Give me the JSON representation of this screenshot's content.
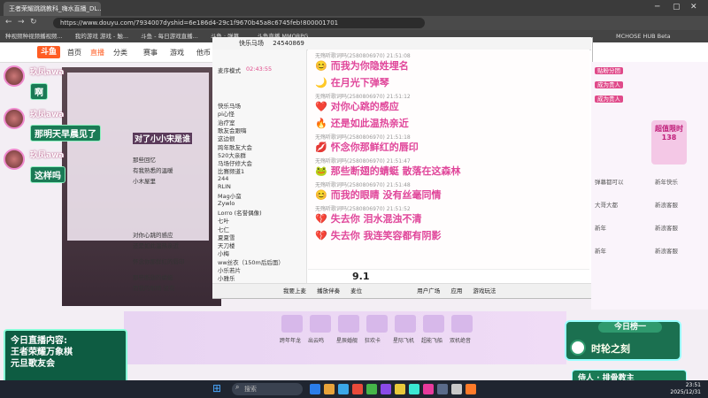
{
  "browser": {
    "tab_title": "王者荣耀跳跳教科_嗨水直播_DL...",
    "url": "https://www.douyu.com/7934007dyshid=6e186d4-29c1f9670b45a8c6745feb!800001701",
    "bookmarks": [
      "种视频种视频播视频...",
      "我的游戏 游戏 - 触...",
      "斗鱼 - 每日游戏直播...",
      "斗鱼 · 弹幕...",
      "斗鱼直播 MMORPG",
      "MCHOSE HUB Beta"
    ]
  },
  "site": {
    "logo": "斗鱼",
    "nav": [
      "首页",
      "直播",
      "分类",
      "赛事",
      "游戏",
      "他币"
    ],
    "active_nav": "直播"
  },
  "left_chat": [
    {
      "user": "玖凤awa",
      "message": "啊"
    },
    {
      "user": "玖凤awa",
      "message": "那明天早晨见了"
    },
    {
      "user": "玖凤awa",
      "message": "这样吗"
    }
  ],
  "qq_window": {
    "title": "快乐马场",
    "room_id": "24540869",
    "mode": "麦序模式",
    "timer": "02:43:55",
    "list_items": [
      "快乐马场",
      "pi心怪",
      "治疗室",
      "歌友会跟嗨",
      "这边很",
      "跨年歌友大会",
      "520大亲群",
      "马场仔修大会",
      "比赛频道1",
      "244",
      "RLIN",
      "Mag小蛮",
      "Zywlo",
      "Lorro (名誉偶像)",
      "七叶",
      "七仁",
      "夏夏雪",
      "天刀楼",
      "小梅",
      "ww丝衣（150m后后面）",
      "小乐若片",
      "小雅乐"
    ],
    "messages": [
      {
        "meta": "无殇听歌词吗(2580806970) 21:51:08",
        "line": "而我为你隐姓埋名",
        "emoji": "😊"
      },
      {
        "meta": "",
        "line": "在月光下弹琴",
        "emoji": "🌙"
      },
      {
        "meta": "无殇听歌词吗(2580806970) 21:51:12",
        "line": "对你心跳的感应",
        "emoji": "❤️"
      },
      {
        "meta": "",
        "line": "还是如此温热亲近",
        "emoji": "🔥"
      },
      {
        "meta": "无殇听歌词吗(2580806970) 21:51:18",
        "line": "怀念你那鲜红的唇印",
        "emoji": "💋"
      },
      {
        "meta": "无殇听歌词吗(2580806970) 21:51:47",
        "line": "那些断翅的蜻蜓 散落在这森林",
        "emoji": "🐸"
      },
      {
        "meta": "无殇听歌词吗(2580806970) 21:51:48",
        "line": "而我的眼睛 没有丝毫同情",
        "emoji": "😊"
      },
      {
        "meta": "无殇听歌词吗(2580806970) 21:51:52",
        "line": "失去你 泪水混浊不清",
        "emoji": "💔"
      },
      {
        "meta": "",
        "line": "失去你 我连笑容都有阴影",
        "emoji": "💔"
      }
    ],
    "input_value": "9.1",
    "bottom_items": [
      "我要上麦",
      "播放伴奏",
      "麦位",
      "用户广场",
      "应用",
      "游戏玩法"
    ]
  },
  "right_sidebar": {
    "tags": [
      "贴粉分团",
      "成为贵人",
      "成为贵人"
    ],
    "items": [
      "弹幕都可以",
      "新年快乐",
      "大哥大都",
      "新浪客服",
      "新年",
      "新浪客服",
      "新年",
      "新浪客服"
    ],
    "promo": "超值限时 138"
  },
  "gifts": [
    {
      "label": "跨年年龙"
    },
    {
      "label": "出云鸣"
    },
    {
      "label": "星辰婚舰"
    },
    {
      "label": "狂欢卡"
    },
    {
      "label": "星际飞机"
    },
    {
      "label": "超能飞船"
    },
    {
      "label": "双机绝音"
    }
  ],
  "overlays": {
    "today_label": "今日直播内容:",
    "today_line1": "王者荣耀万象棋",
    "today_line2": "元旦歌友会",
    "rank_title": "今日榜一",
    "rank_name": "时轮之刻",
    "dj_label": "侍人 · 排骨教主"
  },
  "video_overlay": {
    "lines": [
      "对了小小宋是谁",
      "那些回忆",
      "有我熟悉的温暖",
      "小木屋里",
      "对你心跳的感应",
      "还是如此温热亲近",
      "怀念你那鲜红的唇印",
      "那些断翅的蜻蜓",
      "而我的眼睛 没有"
    ]
  },
  "taskbar": {
    "search_placeholder": "搜索",
    "time": "23:51",
    "date": "2025/12/31"
  }
}
